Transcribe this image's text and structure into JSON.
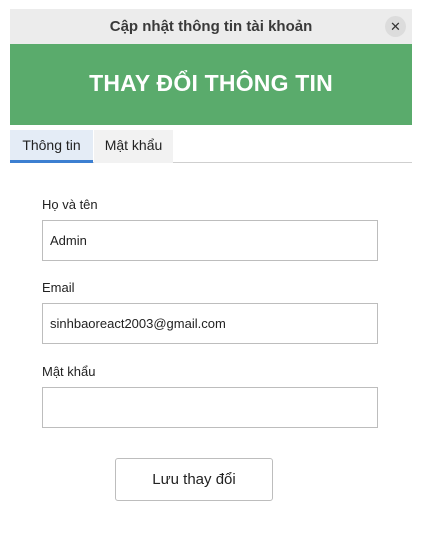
{
  "window": {
    "title": "Cập nhật thông tin tài khoản",
    "close_symbol": "✕",
    "close_icon": "close-icon"
  },
  "banner": {
    "heading": "THAY ĐỔI THÔNG TIN",
    "color": "#5aab6c"
  },
  "tabs": [
    {
      "label": "Thông tin",
      "active": true
    },
    {
      "label": "Mật khẩu",
      "active": false
    }
  ],
  "form": {
    "name": {
      "label": "Họ và tên",
      "value": "Admin"
    },
    "email": {
      "label": "Email",
      "value": "sinhbaoreact2003@gmail.com"
    },
    "password": {
      "label": "Mật khẩu",
      "value": ""
    },
    "save_label": "Lưu thay đổi"
  }
}
